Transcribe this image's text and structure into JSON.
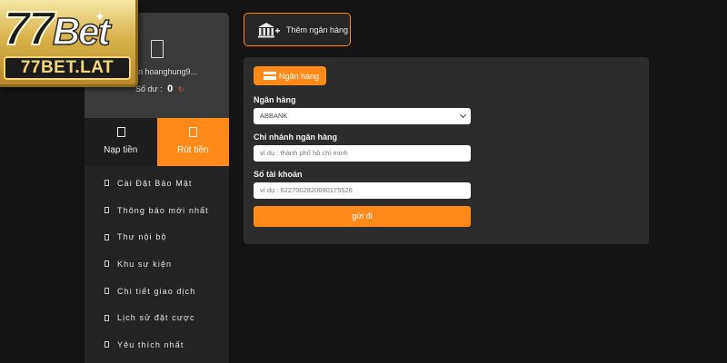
{
  "logo": {
    "brand_number": "77",
    "brand_word": "Bet",
    "domain": "77BET.LAT"
  },
  "profile": {
    "username": "ản hoanghung9...",
    "balance_label": "Số dư :",
    "balance_value": "0"
  },
  "actions": [
    {
      "label": "Nạp tiền",
      "active": false
    },
    {
      "label": "Rút tiền",
      "active": true
    }
  ],
  "menu": [
    {
      "label": "Cài Đặt Bảo Mật"
    },
    {
      "label": "Thông báo mới nhất"
    },
    {
      "label": "Thư nội bộ"
    },
    {
      "label": "Khu sự kiện"
    },
    {
      "label": "Chi tiết giao dịch"
    },
    {
      "label": "Lịch sử đặt cược"
    },
    {
      "label": "Yêu thích nhất"
    }
  ],
  "add_bank": {
    "label": "Thêm ngân hàng"
  },
  "form": {
    "tab_label": "Ngân hàng",
    "bank": {
      "label": "Ngân hàng",
      "value": "ABBANK"
    },
    "branch": {
      "label": "Chi nhánh ngân hàng",
      "placeholder": "ví dụ : thành phố hồ chí minh"
    },
    "account": {
      "label": "Số tài khoản",
      "placeholder": "ví dụ : 6227002820690175526"
    },
    "submit_label": "gửi đi"
  },
  "colors": {
    "accent": "#ff8a1a",
    "background": "#141414",
    "panel": "#2c2c2c",
    "sidebar": "#232323"
  }
}
